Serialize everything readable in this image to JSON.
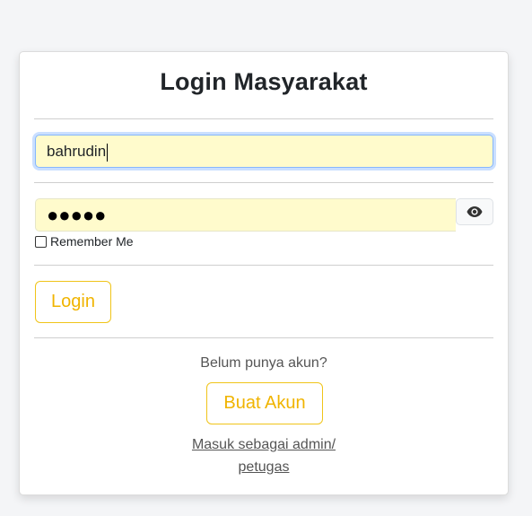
{
  "page": {
    "title": "Login Masyarakat"
  },
  "form": {
    "username_value": "bahrudin",
    "password_masked": "●●●●●",
    "remember_label": "Remember Me",
    "remember_checked": false,
    "login_label": "Login"
  },
  "footer": {
    "no_account_text": "Belum punya akun?",
    "create_account_label": "Buat Akun",
    "admin_link_line1": "Masuk sebagai admin/",
    "admin_link_line2": "petugas"
  },
  "colors": {
    "accent": "#f0c419",
    "input_autofill": "#fffbcc",
    "focus_ring": "#86b7fe"
  },
  "icons": {
    "toggle_password": "eye-icon"
  }
}
